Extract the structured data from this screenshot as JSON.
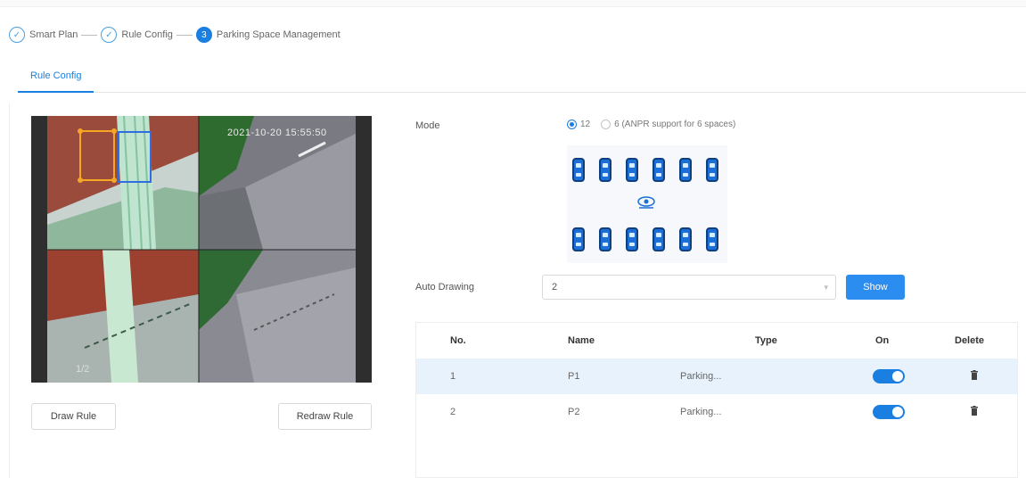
{
  "steps": [
    {
      "label": "Smart Plan",
      "state": "done"
    },
    {
      "label": "Rule Config",
      "state": "done"
    },
    {
      "label": "Parking Space Management",
      "state": "current",
      "number": "3"
    }
  ],
  "tabs": [
    {
      "label": "Rule Config",
      "active": true
    }
  ],
  "video": {
    "timestamp": "2021-10-20 15:55:50",
    "corner_label": "1/2"
  },
  "buttons": {
    "draw_rule": "Draw Rule",
    "redraw_rule": "Redraw Rule",
    "show": "Show"
  },
  "mode": {
    "label": "Mode",
    "options": [
      {
        "label": "12",
        "selected": true
      },
      {
        "label": "6 (ANPR support for 6 spaces)",
        "selected": false
      }
    ]
  },
  "auto_drawing": {
    "label": "Auto Drawing",
    "value": "2"
  },
  "table": {
    "headers": {
      "no": "No.",
      "name": "Name",
      "type": "Type",
      "on": "On",
      "delete": "Delete"
    },
    "rows": [
      {
        "no": "1",
        "name": "P1",
        "type": "Parking...",
        "on": true,
        "selected": true
      },
      {
        "no": "2",
        "name": "P2",
        "type": "Parking...",
        "on": true,
        "selected": false
      }
    ]
  },
  "colors": {
    "accent": "#1a7fe0",
    "show_button": "#2b8df0",
    "selected_row": "#e8f2fc",
    "car": "#1b6fd6"
  }
}
